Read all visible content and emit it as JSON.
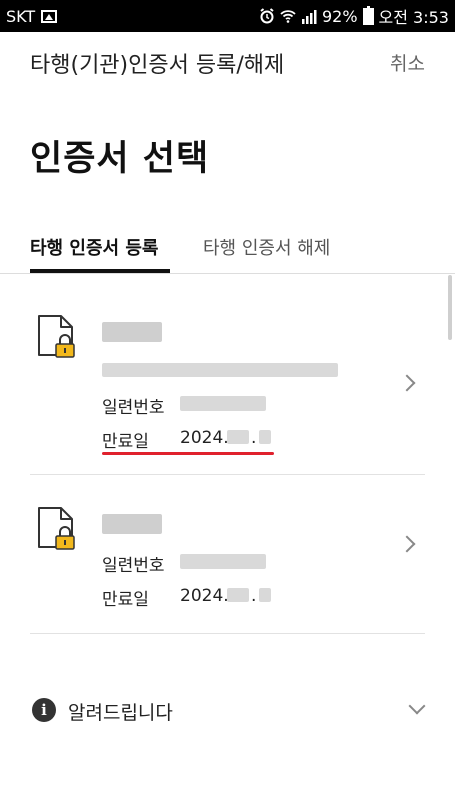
{
  "status_bar": {
    "carrier": "SKT",
    "battery": "92%",
    "time": "오전 3:53"
  },
  "header": {
    "title": "타행(기관)인증서 등록/해제",
    "cancel_label": "취소"
  },
  "page_title": "인증서 선택",
  "tabs": [
    {
      "label": "타행 인증서 등록",
      "active": true
    },
    {
      "label": "타행 인증서 해제",
      "active": false
    }
  ],
  "certificates": [
    {
      "serial_label": "일련번호",
      "expiry_label": "만료일",
      "expiry_value": "2024.",
      "expiry_sep": "."
    },
    {
      "serial_label": "일련번호",
      "expiry_label": "만료일",
      "expiry_value": "2024.",
      "expiry_sep": "."
    }
  ],
  "notice": {
    "icon": "info-icon",
    "label": "알려드립니다"
  },
  "colors": {
    "accent_underline": "#e0212d",
    "lock": "#f2b81c"
  }
}
